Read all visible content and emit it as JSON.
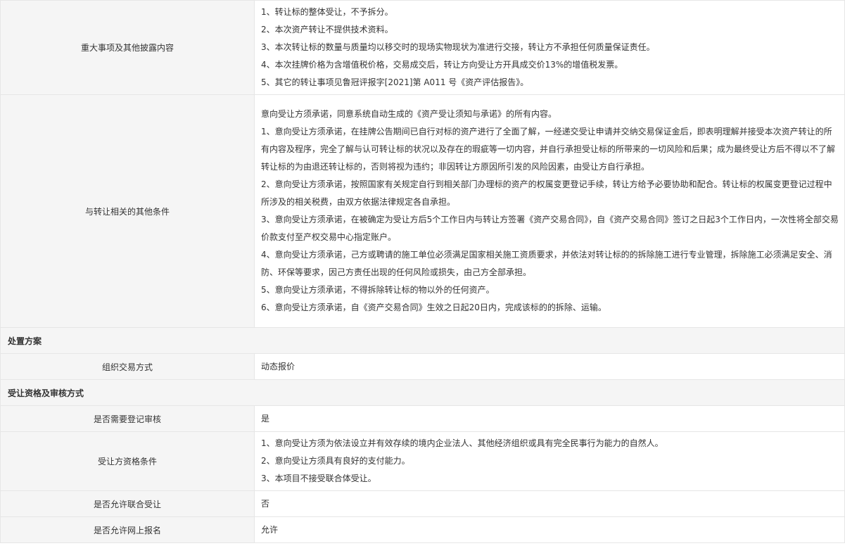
{
  "rows": {
    "disclosure": {
      "label": "重大事项及其他披露内容",
      "lines": [
        "1、转让标的整体受让，不予拆分。",
        "2、本次资产转让不提供技术资料。",
        "3、本次转让标的数量与质量均以移交时的现场实物现状为准进行交接，转让方不承担任何质量保证责任。",
        "4、本次挂牌价格为含增值税价格，交易成交后，转让方向受让方开具成交价13%的增值税发票。",
        "5、其它的转让事项见鲁冠评报字[2021]第 A011 号《资产评估报告》。"
      ]
    },
    "other_conditions": {
      "label": "与转让相关的其他条件",
      "paragraphs": [
        "意向受让方须承诺，同意系统自动生成的《资产受让须知与承诺》的所有内容。",
        "1、意向受让方须承诺，在挂牌公告期间已自行对标的资产进行了全面了解，一经递交受让申请并交纳交易保证金后，即表明理解并接受本次资产转让的所有内容及程序，完全了解与认可转让标的状况以及存在的瑕疵等一切内容，并自行承担受让标的所带来的一切风险和后果；成为最终受让方后不得以不了解转让标的为由退还转让标的，否则将视为违约；非因转让方原因所引发的风险因素，由受让方自行承担。",
        "2、意向受让方须承诺，按照国家有关规定自行到相关部门办理标的资产的权属变更登记手续，转让方给予必要协助和配合。转让标的权属变更登记过程中所涉及的相关税费，由双方依据法律规定各自承担。",
        "3、意向受让方须承诺，在被确定为受让方后5个工作日内与转让方签署《资产交易合同》，自《资产交易合同》签订之日起3个工作日内，一次性将全部交易价款支付至产权交易中心指定账户。",
        "4、意向受让方须承诺，己方或聘请的施工单位必须满足国家相关施工资质要求，并依法对转让标的的拆除施工进行专业管理，拆除施工必须满足安全、消防、环保等要求，因己方责任出现的任何风险或损失，由己方全部承担。",
        "5、意向受让方须承诺，不得拆除转让标的物以外的任何资产。",
        "6、意向受让方须承诺，自《资产交易合同》生效之日起20日内，完成该标的的拆除、运输。"
      ]
    },
    "plan_section": "处置方案",
    "trade_method": {
      "label": "组织交易方式",
      "value": "动态报价"
    },
    "qualification_section": "受让资格及审核方式",
    "need_review": {
      "label": "是否需要登记审核",
      "value": "是"
    },
    "qualification": {
      "label": "受让方资格条件",
      "lines": [
        "1、意向受让方须为依法设立并有效存续的境内企业法人、其他经济组织或具有完全民事行为能力的自然人。",
        "2、意向受让方须具有良好的支付能力。",
        "3、本项目不接受联合体受让。"
      ]
    },
    "joint_bid": {
      "label": "是否允许联合受让",
      "value": "否"
    },
    "online_signup": {
      "label": "是否允许网上报名",
      "value": "允许"
    }
  }
}
